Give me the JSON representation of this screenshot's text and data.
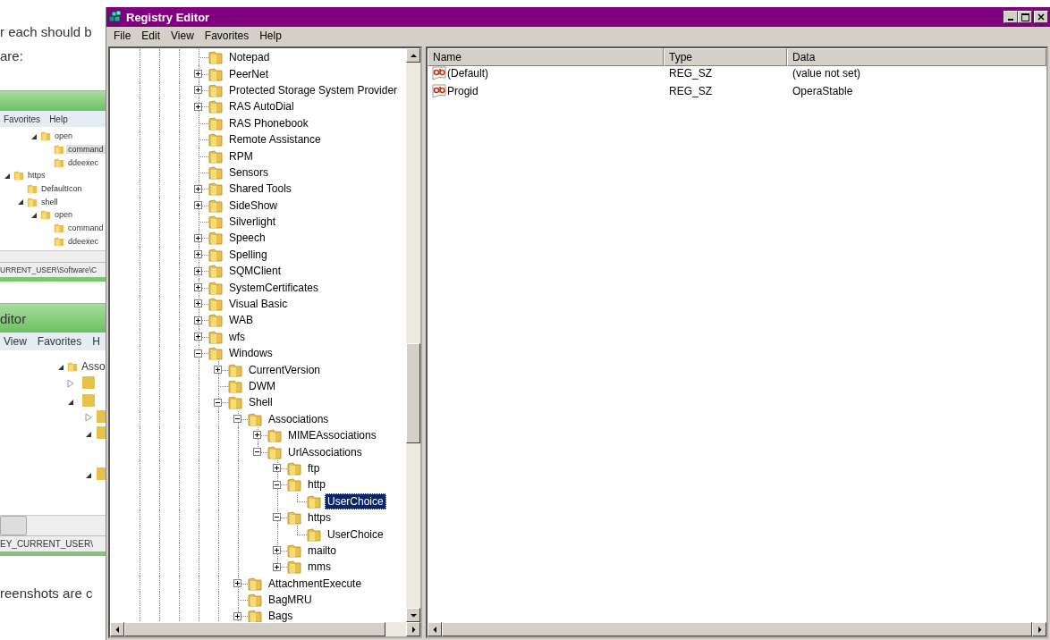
{
  "background_page": {
    "lines_top": [
      "r each should b",
      "are:"
    ],
    "screenshot_1": {
      "menu": [
        "Favorites",
        "Help"
      ],
      "continued": [
        {
          "label": "open",
          "kind": "branch",
          "expanded": true,
          "selected": false,
          "children": [
            {
              "label": "command",
              "kind": "leaf",
              "selected": true
            },
            {
              "label": "ddeexec",
              "kind": "leaf",
              "selected": false
            }
          ]
        }
      ],
      "tree": [
        {
          "label": "https",
          "kind": "branch",
          "expanded": true,
          "selected": false,
          "children": [
            {
              "label": "DefaultIcon",
              "kind": "leaf",
              "selected": false
            },
            {
              "label": "shell",
              "kind": "branch",
              "expanded": true,
              "selected": false,
              "children": [
                {
                  "label": "open",
                  "kind": "branch",
                  "expanded": true,
                  "selected": false,
                  "children": [
                    {
                      "label": "command",
                      "kind": "leaf",
                      "selected": false
                    },
                    {
                      "label": "ddeexec",
                      "kind": "leaf",
                      "selected": false
                    }
                  ]
                }
              ]
            }
          ]
        }
      ],
      "status": "URRENT_USER\\Software\\C"
    },
    "screenshot_2": {
      "title": "ditor",
      "menu": [
        "View",
        "Favorites",
        "H"
      ],
      "tree": [
        {
          "label": "Asso",
          "kind": "branch",
          "expanded": true
        }
      ],
      "status": "EY_CURRENT_USER\\"
    },
    "lines_bottom": [
      "reenshots are c"
    ]
  },
  "window": {
    "title": "Registry Editor"
  },
  "menu": [
    "File",
    "Edit",
    "View",
    "Favorites",
    "Help"
  ],
  "tree": [
    {
      "label": "Notepad",
      "kind": "leaf",
      "selected": false
    },
    {
      "label": "PeerNet",
      "kind": "branch",
      "expanded": false,
      "selected": false
    },
    {
      "label": "Protected Storage System Provider",
      "kind": "branch",
      "expanded": false,
      "selected": false
    },
    {
      "label": "RAS AutoDial",
      "kind": "branch",
      "expanded": false,
      "selected": false
    },
    {
      "label": "RAS Phonebook",
      "kind": "leaf",
      "selected": false
    },
    {
      "label": "Remote Assistance",
      "kind": "leaf",
      "selected": false
    },
    {
      "label": "RPM",
      "kind": "leaf",
      "selected": false
    },
    {
      "label": "Sensors",
      "kind": "leaf",
      "selected": false
    },
    {
      "label": "Shared Tools",
      "kind": "branch",
      "expanded": false,
      "selected": false
    },
    {
      "label": "SideShow",
      "kind": "branch",
      "expanded": false,
      "selected": false
    },
    {
      "label": "Silverlight",
      "kind": "leaf",
      "selected": false
    },
    {
      "label": "Speech",
      "kind": "branch",
      "expanded": false,
      "selected": false
    },
    {
      "label": "Spelling",
      "kind": "branch",
      "expanded": false,
      "selected": false
    },
    {
      "label": "SQMClient",
      "kind": "branch",
      "expanded": false,
      "selected": false
    },
    {
      "label": "SystemCertificates",
      "kind": "branch",
      "expanded": false,
      "selected": false
    },
    {
      "label": "Visual Basic",
      "kind": "branch",
      "expanded": false,
      "selected": false
    },
    {
      "label": "WAB",
      "kind": "branch",
      "expanded": false,
      "selected": false
    },
    {
      "label": "wfs",
      "kind": "branch",
      "expanded": false,
      "selected": false
    },
    {
      "label": "Windows",
      "kind": "branch",
      "expanded": true,
      "selected": false,
      "children": [
        {
          "label": "CurrentVersion",
          "kind": "branch",
          "expanded": false,
          "selected": false
        },
        {
          "label": "DWM",
          "kind": "leaf",
          "selected": false
        },
        {
          "label": "Shell",
          "kind": "branch",
          "expanded": true,
          "selected": false,
          "children": [
            {
              "label": "Associations",
              "kind": "branch",
              "expanded": true,
              "selected": false,
              "children": [
                {
                  "label": "MIMEAssociations",
                  "kind": "branch",
                  "expanded": false,
                  "selected": false
                },
                {
                  "label": "UrlAssociations",
                  "kind": "branch",
                  "expanded": true,
                  "selected": false,
                  "children": [
                    {
                      "label": "ftp",
                      "kind": "branch",
                      "expanded": false,
                      "selected": false
                    },
                    {
                      "label": "http",
                      "kind": "branch",
                      "expanded": true,
                      "selected": false,
                      "children": [
                        {
                          "label": "UserChoice",
                          "kind": "leaf",
                          "selected": true
                        }
                      ]
                    },
                    {
                      "label": "https",
                      "kind": "branch",
                      "expanded": true,
                      "selected": false,
                      "children": [
                        {
                          "label": "UserChoice",
                          "kind": "leaf",
                          "selected": false
                        }
                      ]
                    },
                    {
                      "label": "mailto",
                      "kind": "branch",
                      "expanded": false,
                      "selected": false
                    },
                    {
                      "label": "mms",
                      "kind": "branch",
                      "expanded": false,
                      "selected": false
                    }
                  ]
                }
              ]
            },
            {
              "label": "AttachmentExecute",
              "kind": "branch",
              "expanded": false,
              "selected": false
            },
            {
              "label": "BagMRU",
              "kind": "leaf",
              "selected": false
            },
            {
              "label": "Bags",
              "kind": "branch",
              "expanded": false,
              "selected": false
            }
          ]
        }
      ]
    }
  ],
  "values": {
    "columns": [
      "Name",
      "Type",
      "Data"
    ],
    "rows": [
      {
        "name": "(Default)",
        "type": "REG_SZ",
        "data": "(value not set)"
      },
      {
        "name": "Progid",
        "type": "REG_SZ",
        "data": "OperaStable"
      }
    ]
  }
}
